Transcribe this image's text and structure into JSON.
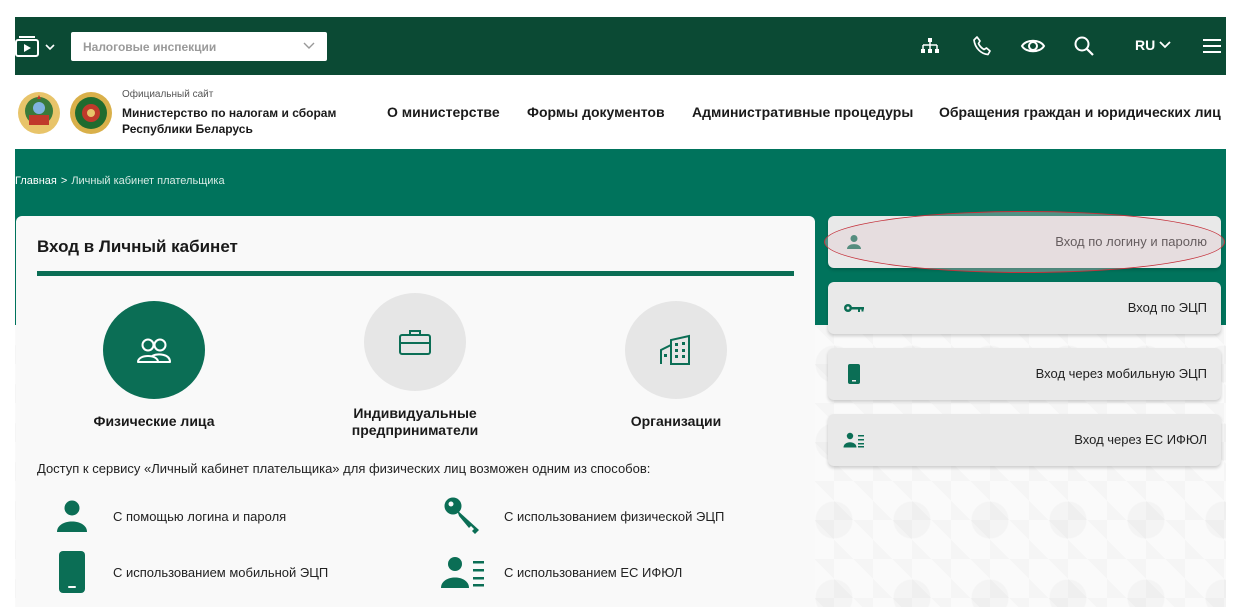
{
  "topbar": {
    "inspection_select": "Налоговые инспекции",
    "lang": "RU",
    "icons": [
      "media-icon",
      "sitemap-icon",
      "phone-icon",
      "eye-icon",
      "search-icon",
      "menu-icon"
    ]
  },
  "header": {
    "subtitle": "Официальный сайт",
    "title": "Министерство по налогам и сборам Республики Беларусь",
    "nav": [
      {
        "label": "О министерстве"
      },
      {
        "label": "Формы документов"
      },
      {
        "label": "Административные процедуры"
      },
      {
        "label": "Обращения граждан и юридических лиц"
      }
    ]
  },
  "breadcrumb": {
    "home": "Главная",
    "separator": ">",
    "current": "Личный кабинет плательщика"
  },
  "login_card": {
    "title": "Вход в Личный кабинет",
    "categories": [
      {
        "label": "Физические лица",
        "active": true
      },
      {
        "label": "Индивидуальные предприниматели",
        "active": false
      },
      {
        "label": "Организации",
        "active": false
      }
    ],
    "access_text": "Доступ к сервису «Личный кабинет плательщика» для физических лиц возможен одним из способов:",
    "methods": [
      {
        "label": "С помощью логина и пароля",
        "icon": "user-icon"
      },
      {
        "label": "С использованием физической ЭЦП",
        "icon": "key-icon"
      },
      {
        "label": "С использованием мобильной ЭЦП",
        "icon": "mobile-icon"
      },
      {
        "label": "С использованием ЕС ИФЮЛ",
        "icon": "id-card-icon"
      }
    ]
  },
  "login_options": [
    {
      "label": "Вход по логину и паролю",
      "icon": "user-icon",
      "highlighted": true
    },
    {
      "label": "Вход по ЭЦП",
      "icon": "key-icon"
    },
    {
      "label": "Вход через мобильную ЭЦП",
      "icon": "mobile-icon"
    },
    {
      "label": "Вход через ЕС ИФЮЛ",
      "icon": "id-card-icon"
    }
  ],
  "colors": {
    "topbar": "#0b4a34",
    "band": "#00735c",
    "accent": "#0b6e55",
    "highlight_oval": "#c4303a"
  }
}
